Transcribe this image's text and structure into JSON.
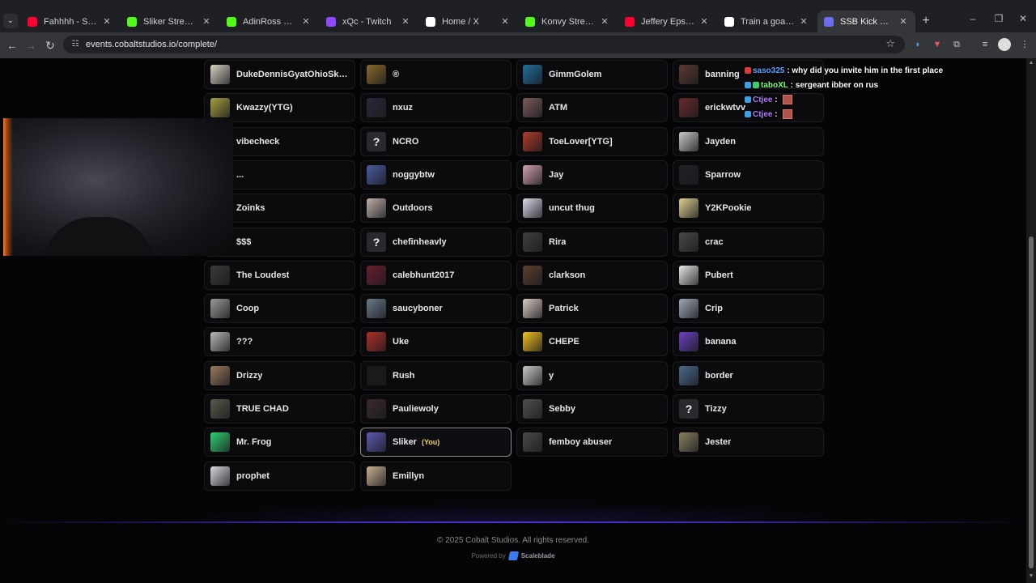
{
  "browser": {
    "tabs": [
      {
        "title": "Fahhhh - Sound effec",
        "icon": "youtube-icon",
        "color": "#ff0033"
      },
      {
        "title": "Sliker Stream - Watch",
        "icon": "kick-icon",
        "color": "#53fc18"
      },
      {
        "title": "AdinRoss Stream - W",
        "icon": "kick-icon",
        "color": "#53fc18"
      },
      {
        "title": "xQc - Twitch",
        "icon": "twitch-icon",
        "color": "#9146ff"
      },
      {
        "title": "Home / X",
        "icon": "x-icon",
        "color": "#ffffff"
      },
      {
        "title": "Konvy Stream - Watc",
        "icon": "kick-icon",
        "color": "#53fc18"
      },
      {
        "title": "Jeffery Epstein edit (t",
        "icon": "youtube-icon",
        "color": "#ff0033"
      },
      {
        "title": "Train a goat 🐐 #train",
        "icon": "tiktok-icon",
        "color": "#ffffff"
      },
      {
        "title": "SSB Kick Event - Coba",
        "icon": "cobalt-icon",
        "color": "#6d6df0",
        "active": true
      }
    ],
    "url": "events.cobaltstudios.io/complete/"
  },
  "participants": [
    {
      "name": "DukeDennisGyatOhioSkib...",
      "avatar": "photo",
      "color": "#d9d2c3"
    },
    {
      "name": "®",
      "avatar": "photo",
      "color": "#8a6a2a"
    },
    {
      "name": "GimmGolem",
      "avatar": "photo",
      "color": "#1f6f9a"
    },
    {
      "name": "banning",
      "avatar": "photo",
      "color": "#5a3a30"
    },
    {
      "name": "Kwazzy(YTG)",
      "avatar": "photo",
      "color": "#a8a040"
    },
    {
      "name": "nxuz",
      "avatar": "photo",
      "color": "#2a2a3a"
    },
    {
      "name": "ATM",
      "avatar": "photo",
      "color": "#7a5a5a"
    },
    {
      "name": "erickwtvv",
      "avatar": "photo",
      "color": "#6a2a2a"
    },
    {
      "name": "vibecheck",
      "avatar": "photo",
      "color": "#8a2020"
    },
    {
      "name": "NCRO",
      "avatar": "unknown",
      "color": "#2a2a2e"
    },
    {
      "name": "ToeLover[YTG]",
      "avatar": "photo",
      "color": "#b03a2a"
    },
    {
      "name": "Jayden",
      "avatar": "photo",
      "color": "#c8c8c8"
    },
    {
      "name": "...",
      "avatar": "photo",
      "color": "#666666"
    },
    {
      "name": "noggybtw",
      "avatar": "photo",
      "color": "#4a5aa0"
    },
    {
      "name": "Jay",
      "avatar": "photo",
      "color": "#d0a0b0"
    },
    {
      "name": "Sparrow",
      "avatar": "photo",
      "color": "#222226"
    },
    {
      "name": "Zoinks",
      "avatar": "photo",
      "color": "#3a3a3a"
    },
    {
      "name": "Outdoors",
      "avatar": "photo",
      "color": "#c0b0a8"
    },
    {
      "name": "uncut thug",
      "avatar": "photo",
      "color": "#d8d8e8"
    },
    {
      "name": "Y2KPookie",
      "avatar": "photo",
      "color": "#e0d090"
    },
    {
      "name": "$$$",
      "avatar": "photo",
      "color": "#3a3a3a"
    },
    {
      "name": "chefinheavly",
      "avatar": "unknown",
      "color": "#2a2a2e"
    },
    {
      "name": "Rira",
      "avatar": "photo",
      "color": "#404040"
    },
    {
      "name": "crac",
      "avatar": "photo",
      "color": "#4a4a4a"
    },
    {
      "name": "The Loudest",
      "avatar": "photo",
      "color": "#3a3a3a"
    },
    {
      "name": "calebhunt2017",
      "avatar": "photo",
      "color": "#6a2030"
    },
    {
      "name": "clarkson",
      "avatar": "photo",
      "color": "#5a4030"
    },
    {
      "name": "Pubert",
      "avatar": "photo",
      "color": "#e8e8e8"
    },
    {
      "name": "Coop",
      "avatar": "photo",
      "color": "#9a9a9a"
    },
    {
      "name": "saucyboner",
      "avatar": "photo",
      "color": "#6a7a8a"
    },
    {
      "name": "Patrick",
      "avatar": "photo",
      "color": "#d8c8c0"
    },
    {
      "name": "Crip",
      "avatar": "photo",
      "color": "#a0a8b8"
    },
    {
      "name": "???",
      "avatar": "photo",
      "color": "#b8b8b8"
    },
    {
      "name": "Uke",
      "avatar": "photo",
      "color": "#b03028"
    },
    {
      "name": "CHEPE",
      "avatar": "photo",
      "color": "#f0c020"
    },
    {
      "name": "banana",
      "avatar": "photo",
      "color": "#6a40c0"
    },
    {
      "name": "Drizzy",
      "avatar": "photo",
      "color": "#9a7a5a"
    },
    {
      "name": "Rush",
      "avatar": "photo",
      "color": "#1a1a1a"
    },
    {
      "name": "y",
      "avatar": "photo",
      "color": "#c8c8c8"
    },
    {
      "name": "border",
      "avatar": "photo",
      "color": "#4a6a8a"
    },
    {
      "name": "TRUE CHAD",
      "avatar": "photo",
      "color": "#5a5a4a"
    },
    {
      "name": "Pauliewoly",
      "avatar": "photo",
      "color": "#3a2a2a"
    },
    {
      "name": "Sebby",
      "avatar": "photo",
      "color": "#505050"
    },
    {
      "name": "Tizzy",
      "avatar": "unknown",
      "color": "#2a2a2e"
    },
    {
      "name": "Mr. Frog",
      "avatar": "photo",
      "color": "#30d070"
    },
    {
      "name": "Sliker",
      "avatar": "photo",
      "color": "#5a5ab0",
      "you": true
    },
    {
      "name": "femboy abuser",
      "avatar": "photo",
      "color": "#4a4a4a"
    },
    {
      "name": "Jester",
      "avatar": "photo",
      "color": "#8a8060"
    },
    {
      "name": "prophet",
      "avatar": "photo",
      "color": "#d8d8e0"
    },
    {
      "name": "Emillyn",
      "avatar": "photo",
      "color": "#c8b090"
    }
  ],
  "you_label": "(You)",
  "unknown_glyph": "?",
  "chat": [
    {
      "user": "saso325",
      "user_color": "#58a6ff",
      "message": " : why did you invite him in the first place",
      "badges": [
        "#e03a3a"
      ]
    },
    {
      "user": "taboXL",
      "user_color": "#7cff7c",
      "message": " : sergeant ibber on rus",
      "badges": [
        "#3aa0e0",
        "#3acf6a"
      ]
    },
    {
      "user": "Ctjee",
      "user_color": "#b57cff",
      "message": " : ",
      "badges": [
        "#3aa0e0"
      ],
      "emote": true
    },
    {
      "user": "Ctjee",
      "user_color": "#b57cff",
      "message": " : ",
      "badges": [
        "#3aa0e0"
      ],
      "emote": true
    }
  ],
  "footer": {
    "copyright": "© 2025 Cobalt Studios. All rights reserved.",
    "powered_by": "Powered by",
    "powered_name": "Scaleblade",
    "accent": "#4a36d0"
  }
}
